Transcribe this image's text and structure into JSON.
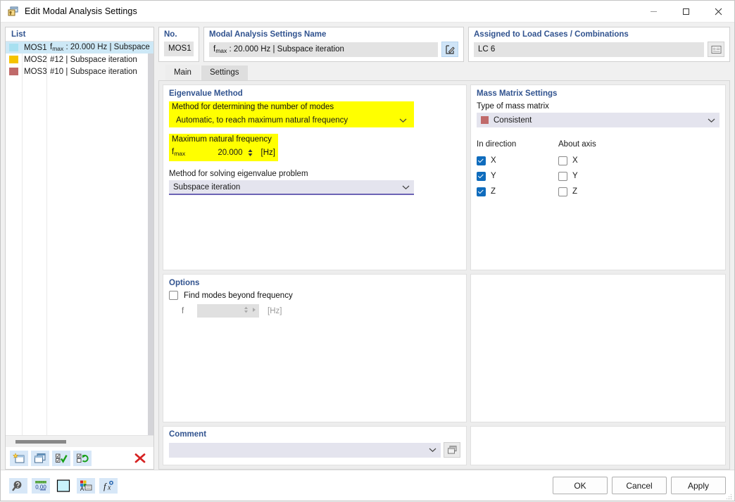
{
  "window": {
    "title": "Edit Modal Analysis Settings",
    "icon": "modal-analysis-icon",
    "minimize_label": "—",
    "maximize_label": "□",
    "close_label": "✕"
  },
  "list_panel": {
    "header": "List",
    "rows": [
      {
        "swatch": "#a8e0f0",
        "id": "MOS1",
        "desc_prefix": "f",
        "desc_sub": "max",
        "desc": " : 20.000 Hz | Subspace",
        "selected": true
      },
      {
        "swatch": "#f5c300",
        "id": "MOS2",
        "desc_prefix": "",
        "desc_sub": "",
        "desc": "#12 | Subspace iteration",
        "selected": false
      },
      {
        "swatch": "#c06a6a",
        "id": "MOS3",
        "desc_prefix": "",
        "desc_sub": "",
        "desc": "#10 | Subspace iteration",
        "selected": false
      }
    ],
    "toolbar": [
      {
        "name": "new-item-button",
        "title": "New"
      },
      {
        "name": "copy-item-button",
        "title": "Copy"
      },
      {
        "name": "select-all-button",
        "title": "Select All"
      },
      {
        "name": "invert-selection-button",
        "title": "Invert Selection"
      },
      {
        "name": "delete-item-button",
        "title": "Delete"
      }
    ]
  },
  "no_field": {
    "label": "No.",
    "value": "MOS1"
  },
  "name_field": {
    "label": "Modal Analysis Settings Name",
    "value_prefix": "f",
    "value_sub": "max",
    "value": " : 20.000 Hz | Subspace iteration",
    "edit_icon": "edit-pencil-icon"
  },
  "load_cases": {
    "label": "Assigned to Load Cases / Combinations",
    "value": "LC 6",
    "browse_icon": "list-card-icon"
  },
  "tabs": [
    {
      "label": "Main",
      "active": true
    },
    {
      "label": "Settings",
      "active": false
    }
  ],
  "eigenvalue_method": {
    "title": "Eigenvalue Method",
    "modes_label": "Method for determining the number of modes",
    "modes_value": "Automatic, to reach maximum natural frequency",
    "max_freq_label": "Maximum natural frequency",
    "fmax_prefix": "f",
    "fmax_sub": "max",
    "fmax_value": "20.000",
    "fmax_unit": "[Hz]",
    "solve_label": "Method for solving eigenvalue problem",
    "solve_value": "Subspace iteration",
    "highlight_color": "#ffff00"
  },
  "mass_matrix": {
    "title": "Mass Matrix Settings",
    "type_label": "Type of mass matrix",
    "type_value": "Consistent",
    "type_swatch": "#c06a6a",
    "in_direction_label": "In direction",
    "about_axis_label": "About axis",
    "in_direction": [
      {
        "label": "X",
        "checked": true
      },
      {
        "label": "Y",
        "checked": true
      },
      {
        "label": "Z",
        "checked": true
      }
    ],
    "about_axis": [
      {
        "label": "X",
        "checked": false
      },
      {
        "label": "Y",
        "checked": false
      },
      {
        "label": "Z",
        "checked": false
      }
    ],
    "checkbox_color": "#0f6cbd"
  },
  "options": {
    "title": "Options",
    "find_modes_label": "Find modes beyond frequency",
    "find_modes_checked": false,
    "f_label": "f",
    "f_value": "",
    "f_unit": "[Hz]"
  },
  "comment": {
    "title": "Comment",
    "value": "",
    "picker_icon": "comment-library-icon"
  },
  "footer": {
    "tools": [
      {
        "name": "help-magnifier-icon"
      },
      {
        "name": "decimal-places-icon"
      },
      {
        "name": "color-swatch-icon"
      },
      {
        "name": "display-properties-icon"
      },
      {
        "name": "formula-icon"
      }
    ],
    "ok_label": "OK",
    "cancel_label": "Cancel",
    "apply_label": "Apply"
  }
}
